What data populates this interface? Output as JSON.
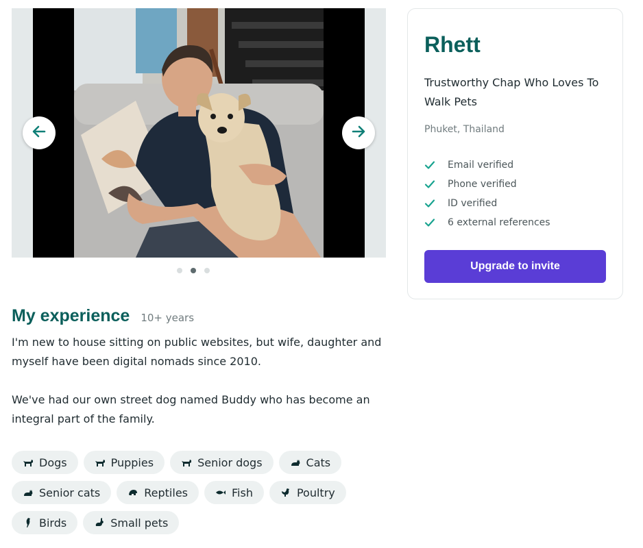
{
  "carousel": {
    "prev_icon": "arrow-left-icon",
    "next_icon": "arrow-right-icon",
    "slide_count": 3,
    "active_slide": 2,
    "accent_color": "#0f7f77"
  },
  "experience": {
    "title": "My experience",
    "years": "10+ years",
    "paragraphs": [
      "I'm new to house sitting on public websites, but wife, daughter and myself have been digital nomads since 2010.",
      "We've had our own street dog named Buddy who has become an integral part of the family."
    ]
  },
  "pets": [
    {
      "label": "Dogs",
      "icon": "dog-icon"
    },
    {
      "label": "Puppies",
      "icon": "dog-icon"
    },
    {
      "label": "Senior dogs",
      "icon": "dog-icon"
    },
    {
      "label": "Cats",
      "icon": "cat-icon"
    },
    {
      "label": "Senior cats",
      "icon": "cat-icon"
    },
    {
      "label": "Reptiles",
      "icon": "turtle-icon"
    },
    {
      "label": "Fish",
      "icon": "fish-icon"
    },
    {
      "label": "Poultry",
      "icon": "chicken-icon"
    },
    {
      "label": "Birds",
      "icon": "bird-icon"
    },
    {
      "label": "Small pets",
      "icon": "rabbit-icon"
    }
  ],
  "profile": {
    "name": "Rhett",
    "tagline": "Trustworthy Chap Who Loves To Walk Pets",
    "location": "Phuket, Thailand",
    "verifications": [
      "Email verified",
      "Phone verified",
      "ID verified",
      "6 external references"
    ],
    "check_icon": "check-icon",
    "upgrade_label": "Upgrade to invite",
    "brand_color": "#0b5f5b",
    "button_color": "#5a3dd6"
  }
}
